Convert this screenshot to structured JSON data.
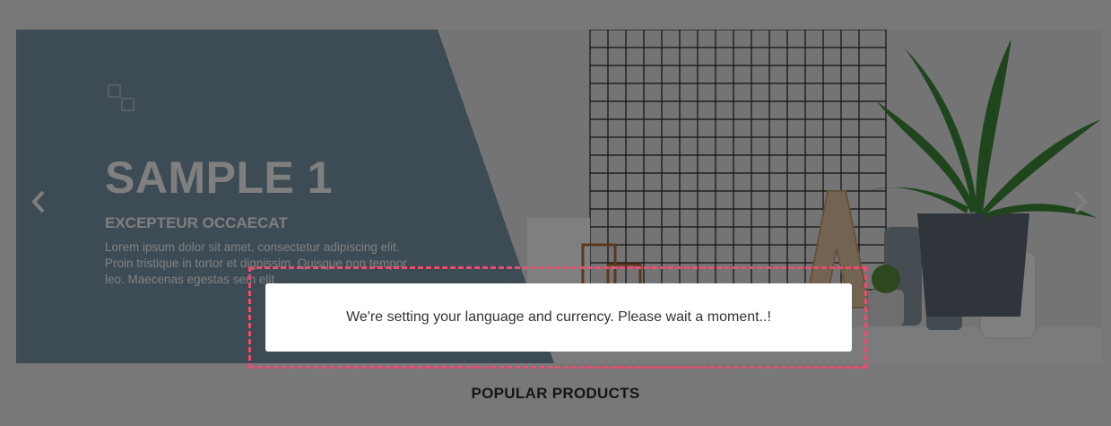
{
  "slider": {
    "title": "SAMPLE 1",
    "subtitle": "EXCEPTEUR OCCAECAT",
    "description": "Lorem ipsum dolor sit amet, consectetur adipiscing elit. Proin tristique in tortor et dignissim. Quisque non tempor leo. Maecenas egestas sem elit",
    "prev_icon": "chevron-left-icon",
    "next_icon": "chevron-right-icon",
    "panel_color": "#7a98a8",
    "scene_items": [
      "grid-panel",
      "letter-a-decor",
      "potted-plant",
      "candles",
      "cactus"
    ]
  },
  "section": {
    "title": "POPULAR PRODUCTS"
  },
  "loading": {
    "message": "We're setting your language and currency. Please wait a moment..!",
    "highlight_color": "#ea4d6f"
  }
}
